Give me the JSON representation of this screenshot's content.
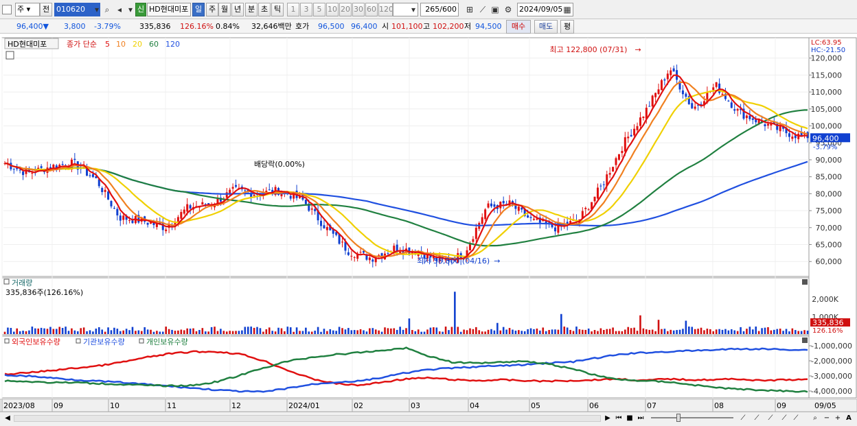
{
  "toolbar": {
    "market": "주",
    "prev": "전",
    "code": "010620",
    "stock_name": "HD현대미포",
    "new_badge": "신",
    "periods": [
      "일",
      "주",
      "월",
      "년",
      "분",
      "초",
      "틱"
    ],
    "selected_period": "일",
    "intervals": [
      "1",
      "3",
      "5",
      "10",
      "20",
      "30",
      "60",
      "120"
    ],
    "count": "265",
    "count_max": "/600",
    "date": "2024/09/05"
  },
  "quote": {
    "price": "96,400",
    "arrow": "▼",
    "change": "3,800",
    "change_pct": "-3.79%",
    "volume": "335,836",
    "vol_ratio": "126.16%",
    "turnover": "0.84%",
    "amount": "32,646백만",
    "ask_bid_label": "호가",
    "ask": "96,500",
    "bid": "96,400",
    "open_label": "시",
    "open": "101,100",
    "high_label": "고",
    "high": "102,200",
    "low_label": "저",
    "low": "94,500",
    "buy_btn": "매수",
    "sell_btn": "매도",
    "eval_btn": "평"
  },
  "price_panel": {
    "legend_name": "HD현대미포",
    "legend_ma_label": "종가 단순",
    "ma": [
      {
        "p": "5",
        "color": "#e01010"
      },
      {
        "p": "10",
        "color": "#f08020"
      },
      {
        "p": "20",
        "color": "#f0d000"
      },
      {
        "p": "60",
        "color": "#208040"
      },
      {
        "p": "120",
        "color": "#2050e0"
      }
    ],
    "lc": "LC:63.95",
    "hc": "HC:-21.50",
    "current_tag": "96,400",
    "current_pct": "-3.79%",
    "high_annot": "최고 122,800 (07/31)",
    "low_annot": "최저 58,800 (04/16)",
    "dividend_annot": "배당락(0.00%)",
    "yticks": [
      "120,000",
      "115,000",
      "110,000",
      "105,000",
      "100,000",
      "95,000",
      "90,000",
      "85,000",
      "80,000",
      "75,000",
      "70,000",
      "65,000",
      "60,000"
    ]
  },
  "volume_panel": {
    "title": "거래량",
    "summary": "335,836주(126.16%)",
    "yticks": [
      "2,000K",
      "1,000K"
    ],
    "tag": "335,836",
    "tag_pct": "126.16%"
  },
  "holding_panel": {
    "series": [
      {
        "name": "외국인보유수량",
        "color": "#e01010"
      },
      {
        "name": "기관보유수량",
        "color": "#2050e0"
      },
      {
        "name": "개인보유수량",
        "color": "#208040"
      }
    ],
    "yticks": [
      "-1,000,000",
      "-2,000,000",
      "-3,000,000",
      "-4,000,000"
    ]
  },
  "xaxis": [
    "2023/08",
    "09",
    "10",
    "11",
    "12",
    "2024/01",
    "02",
    "03",
    "04",
    "05",
    "06",
    "07",
    "08",
    "09"
  ],
  "xaxis_right": "09/05",
  "chart_data": {
    "type": "candlestick",
    "ylim": [
      56000,
      126000
    ],
    "month_close": [
      {
        "m": "2023/08",
        "v": 86000
      },
      {
        "m": "09",
        "v": 89000
      },
      {
        "m": "10",
        "v": 73000
      },
      {
        "m": "11",
        "v": 77000
      },
      {
        "m": "12",
        "v": 81000
      },
      {
        "m": "2024/01",
        "v": 80000
      },
      {
        "m": "02",
        "v": 63000
      },
      {
        "m": "03",
        "v": 64000
      },
      {
        "m": "04",
        "v": 61000
      },
      {
        "m": "05",
        "v": 77000
      },
      {
        "m": "06",
        "v": 70000
      },
      {
        "m": "07",
        "v": 117000
      },
      {
        "m": "08",
        "v": 104000
      },
      {
        "m": "09",
        "v": 96400
      }
    ],
    "annotations": {
      "high": 122800,
      "low": 58800,
      "last": 96400
    }
  }
}
